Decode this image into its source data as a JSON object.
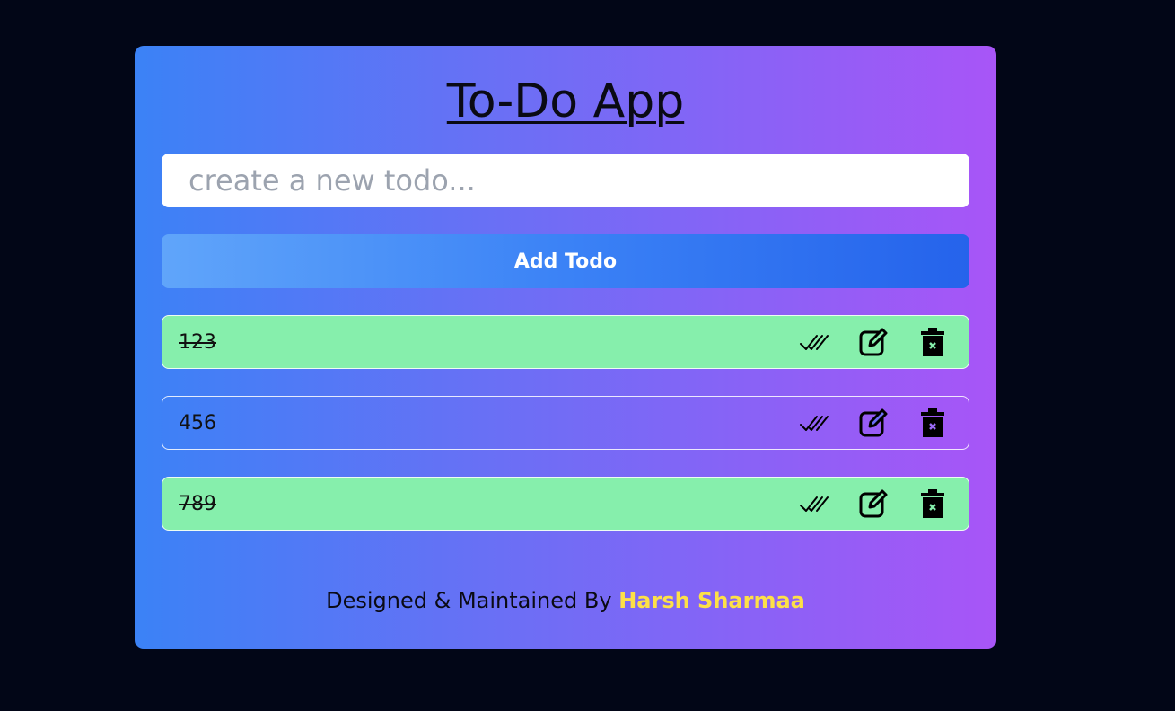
{
  "app": {
    "title": "To-Do App"
  },
  "input": {
    "placeholder": "create a new todo...",
    "value": ""
  },
  "add_button": {
    "label": "Add Todo"
  },
  "todos": [
    {
      "text": "123",
      "completed": true
    },
    {
      "text": "456",
      "completed": false
    },
    {
      "text": "789",
      "completed": true
    }
  ],
  "footer": {
    "prefix": "Designed & Maintained By",
    "author": "Harsh Sharmaa"
  },
  "icons": {
    "complete": "double-check-icon",
    "edit": "edit-icon",
    "delete": "trash-icon"
  },
  "colors": {
    "background": "#020617",
    "card_gradient_start": "#3b82f6",
    "card_gradient_end": "#a855f7",
    "completed_item": "#86efac",
    "author": "#fde047"
  }
}
